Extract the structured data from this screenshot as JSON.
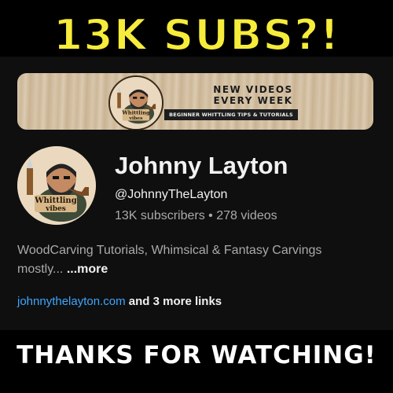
{
  "headline": "13K SUBS?!",
  "banner": {
    "title_line1": "NEW VIDEOS",
    "title_line2": "EVERY WEEK",
    "tagline": "BEGINNER WHITTLING TIPS & TUTORIALS",
    "logo_text_1": "Whittling",
    "logo_text_2": "vibes"
  },
  "avatar": {
    "logo_text_1": "Whittling",
    "logo_text_2": "vibes"
  },
  "channel": {
    "name": "Johnny Layton",
    "handle": "@JohnnyTheLayton",
    "subscribers": "13K subscribers",
    "separator": "•",
    "videos": "278 videos",
    "description": "WoodCarving Tutorials, Whimsical & Fantasy Carvings mostly...",
    "more_label": "...more",
    "link": "johnnythelayton.com",
    "more_links": "and 3 more links"
  },
  "footer": "THANKS FOR WATCHING!",
  "colors": {
    "headline": "#f6ec3a",
    "panel_bg": "#0f0f0f",
    "link": "#3ea6ff",
    "secondary_text": "#aaaaaa",
    "primary_text": "#f1f1f1"
  }
}
